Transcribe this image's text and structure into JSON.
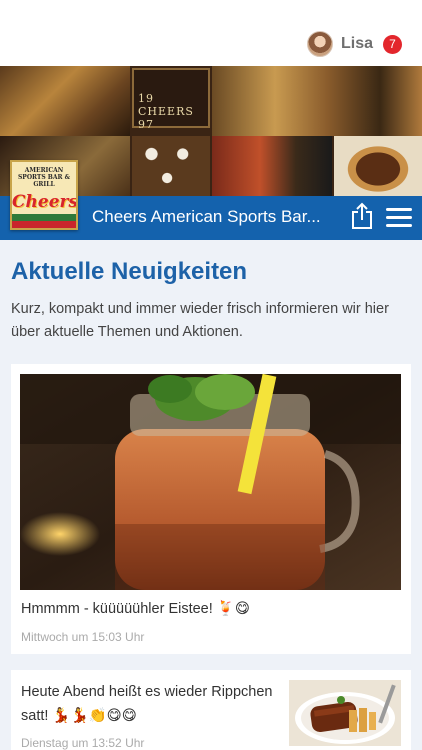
{
  "user": {
    "name": "Lisa",
    "notifications": "7"
  },
  "brand": {
    "title": "Cheers American Sports Bar...",
    "logo_top": "AMERICAN SPORTS BAR & GRILL",
    "logo_word": "Cheers"
  },
  "banner": {
    "sign": "19 CHEERS 97"
  },
  "news": {
    "heading": "Aktuelle Neuigkeiten",
    "intro": "Kurz, kompakt und immer wieder frisch informieren wir hier über aktuelle Themen und Aktionen.",
    "posts": [
      {
        "text": "Hmmmm - küüüüühler Eistee! 🍹😋",
        "date": "Mittwoch um 15:03 Uhr"
      },
      {
        "text": "Heute Abend heißt es wieder Rippchen satt! 💃💃👏😋😋",
        "date": "Dienstag um 13:52 Uhr"
      }
    ]
  }
}
